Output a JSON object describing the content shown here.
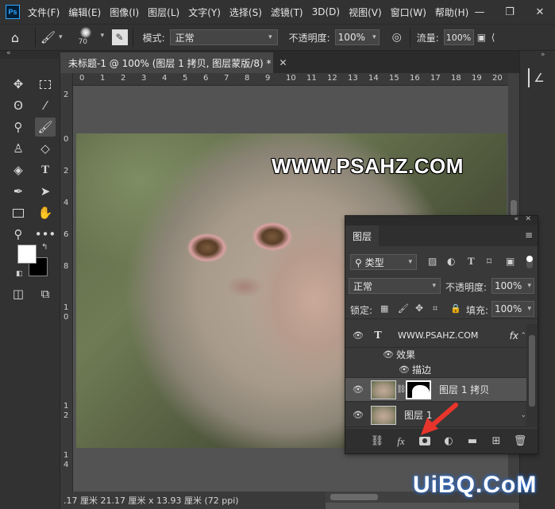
{
  "app": {
    "logo": "Ps"
  },
  "menu": [
    "文件(F)",
    "编辑(E)",
    "图像(I)",
    "图层(L)",
    "文字(Y)",
    "选择(S)",
    "滤镜(T)",
    "3D(D)",
    "视图(V)",
    "窗口(W)",
    "帮助(H)"
  ],
  "options": {
    "brush_size": "70",
    "mode_label": "模式:",
    "mode_value": "正常",
    "opacity_label": "不透明度:",
    "opacity_value": "100%",
    "flow_label": "流量:",
    "flow_value": "100%"
  },
  "document": {
    "tab_title": "未标题-1 @ 100% (图层 1 拷贝, 图层蒙版/8) *",
    "watermark": "WWW.PSAHZ.COM",
    "status": ".17 厘米   21.17 厘米 x 13.93 厘米 (72 ppi)"
  },
  "rulers": {
    "h": [
      "0",
      "1",
      "2",
      "3",
      "4",
      "5",
      "6",
      "7",
      "8",
      "9",
      "10",
      "11",
      "12",
      "13",
      "14",
      "15",
      "16",
      "17",
      "18",
      "19",
      "20",
      "21"
    ],
    "v": [
      "2",
      "0",
      "2",
      "4",
      "6",
      "8",
      "1",
      "0",
      "1",
      "2",
      "1",
      "4"
    ]
  },
  "layers_panel": {
    "tab": "图层",
    "filter_label": "类型",
    "blend_mode": "正常",
    "opacity_label": "不透明度:",
    "opacity_value": "100%",
    "lock_label": "锁定:",
    "fill_label": "填充:",
    "fill_value": "100%",
    "layers": [
      {
        "name": "WWW.PSAHZ.COM",
        "type": "text",
        "fx": "fx"
      },
      {
        "name": "效果",
        "type": "effects-group"
      },
      {
        "name": "描边",
        "type": "effect"
      },
      {
        "name": "图层 1 拷贝",
        "type": "pixel-with-mask",
        "selected": true
      },
      {
        "name": "图层 1",
        "type": "pixel"
      }
    ],
    "bottom_fx": "fx"
  },
  "brand": "UiBQ.CoM",
  "colors": {
    "accent": "#31a8ff",
    "arrow": "#e8352b",
    "foreground": "#ffffff",
    "background": "#000000"
  }
}
